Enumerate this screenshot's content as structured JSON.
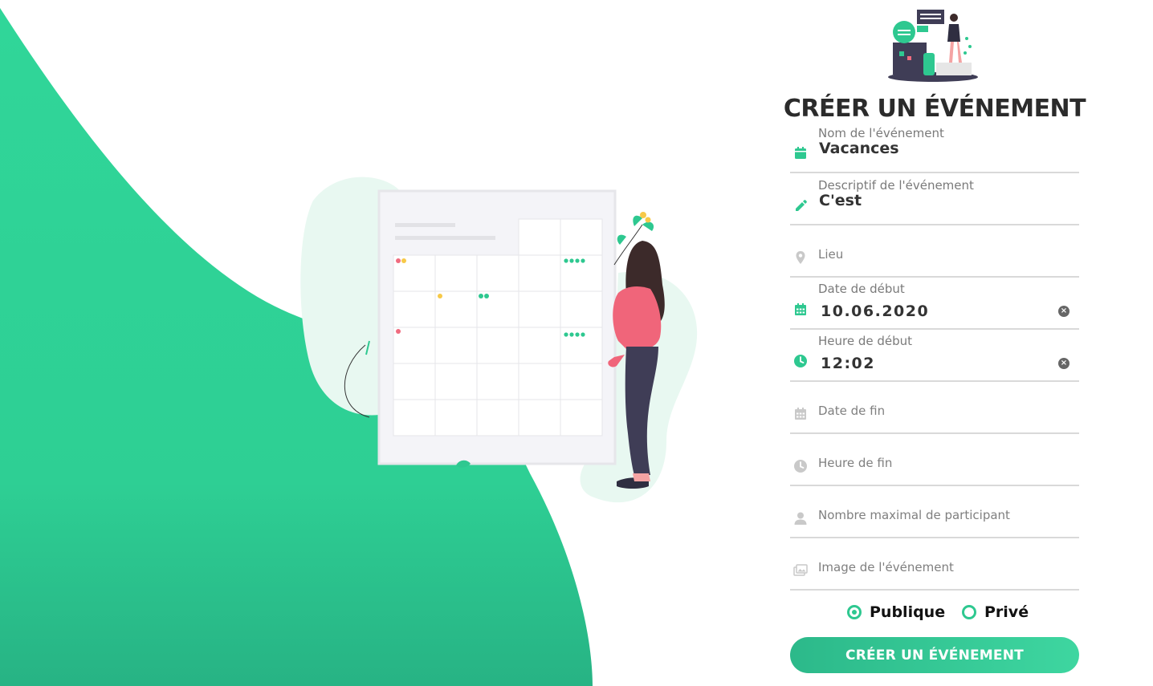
{
  "form": {
    "title": "CRÉER UN ÉVÉNEMENT",
    "fields": [
      {
        "icon": "calendar-icon",
        "label": "Nom de l'événement",
        "value": "Vacances"
      },
      {
        "icon": "pencil-icon",
        "label": "Descriptif de l'événement",
        "value": "C'est"
      },
      {
        "icon": "map-pin-icon",
        "placeholder": "Lieu"
      },
      {
        "icon": "calendar-grid-icon",
        "label": "Date de début",
        "value": "10.06.2020"
      },
      {
        "icon": "clock-icon",
        "label": "Heure de début",
        "value": "12:02"
      },
      {
        "icon": "calendar-grid-icon",
        "placeholder": "Date de fin"
      },
      {
        "icon": "clock-icon",
        "placeholder": "Heure de fin"
      },
      {
        "icon": "user-icon",
        "placeholder": "Nombre maximal de participant"
      },
      {
        "icon": "image-icon",
        "placeholder": "Image de l'événement"
      }
    ],
    "visibility": {
      "options": [
        {
          "label": "Publique",
          "selected": true
        },
        {
          "label": "Privé",
          "selected": false
        }
      ]
    },
    "submit_label": "CRÉER UN ÉVÉNEMENT"
  },
  "colors": {
    "accent": "#2ec890",
    "wave": "#2ecf94",
    "title": "#2b2b2b",
    "field_line": "#d9d9d9"
  }
}
